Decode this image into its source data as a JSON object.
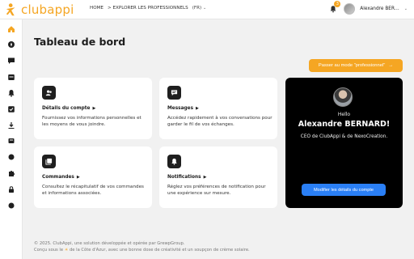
{
  "app": {
    "logo_text": "clubappi",
    "brand_color": "#f5a623"
  },
  "nav": {
    "home": "HOME",
    "explore": "> EXPLORER LES PROFESSIONNELS",
    "lang": "(FR)"
  },
  "user": {
    "name": "Alexandre BER…",
    "notifications": "3"
  },
  "sidebar": {
    "items": [
      {
        "icon": "home-icon",
        "active": true
      },
      {
        "icon": "compass-icon"
      },
      {
        "icon": "chat-icon"
      },
      {
        "icon": "calendar-icon"
      },
      {
        "icon": "bell-icon"
      },
      {
        "icon": "orders-icon"
      },
      {
        "icon": "download-icon"
      },
      {
        "icon": "settings-icon"
      },
      {
        "icon": "dot-icon"
      },
      {
        "icon": "puzzle-icon"
      },
      {
        "icon": "lock-icon"
      },
      {
        "icon": "dot-icon"
      }
    ]
  },
  "main": {
    "title": "Tableau de bord",
    "pro_button": "Passer au mode \"professionnel\"",
    "cards": [
      {
        "title": "Détails du compte",
        "desc": "Fournissez vos informations personnelles et les moyens de vous joindre.",
        "icon": "user-icon"
      },
      {
        "title": "Messages",
        "desc": "Accédez rapidement à vos conversations pour garder le fil de vos échanges.",
        "icon": "message-icon"
      },
      {
        "title": "Commandes",
        "desc": "Consultez le récapitulatif de vos commandes et informations associées.",
        "icon": "orders-icon"
      },
      {
        "title": "Notifications",
        "desc": "Réglez vos préférences de notification pour une expérience sur mesure.",
        "icon": "bell-icon"
      }
    ]
  },
  "profile": {
    "hello": "Hello",
    "name": "Alexandre BERNARD!",
    "role": "CEO de ClubAppi & de NexoCreation.",
    "button": "Modifier les détails du compte"
  },
  "footer": {
    "line1": "© 2025. ClubAppi, une solution développée et opérée par GrewpGroup.",
    "line2_pre": "Conçu sous le",
    "line2_post": "de la Côte d'Azur, avec une bonne dose de créativité et un soupçon de crème solaire."
  }
}
